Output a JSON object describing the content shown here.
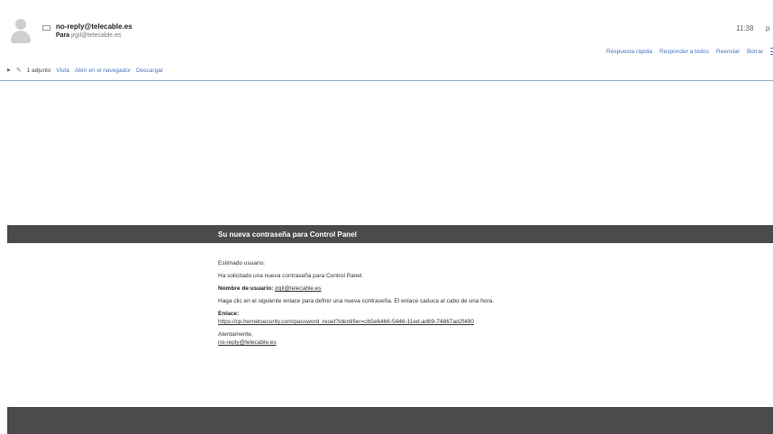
{
  "header": {
    "sender": "no-reply@telecable.es",
    "to_label": "Para",
    "to_value": "jrgil@telecable.es",
    "time": "11:38",
    "time_extra": "p"
  },
  "actions": [
    "Respuesta rápida",
    "Responder a todos",
    "Reenviar",
    "Borrar"
  ],
  "attachments": {
    "count": "1 adjunto",
    "view": "Vista",
    "open_browser": "Abrir en el navegador",
    "download": "Descargar"
  },
  "email": {
    "title": "Su nueva contraseña para Control Panel",
    "greeting": "Estimado usuario:",
    "line1": "Ha solicitado una nueva contraseña para Control Panel.",
    "username_label": "Nombre de usuario:",
    "username": "jrgil@telecable.es",
    "instructions": "Haga clic en el siguiente enlace para definir una nueva contraseña. El enlace caduca al cabo de una hora.",
    "link_label": "Enlace:",
    "link": "https://cp.hornetsecurity.com/password_reset?identifier=cb5e6466-5446-11ed-ad89-74867ad2f490",
    "closing": "Atentamente,",
    "signature": "no-reply@telecable.es"
  },
  "colors": {
    "accent": "#4a73b8",
    "banner": "#4b4b4b"
  }
}
